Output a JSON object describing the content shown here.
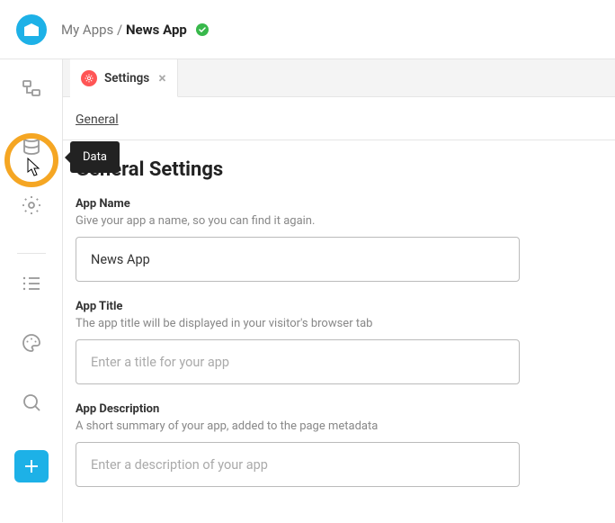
{
  "breadcrumb": {
    "root": "My Apps",
    "sep": "/",
    "current": "News App"
  },
  "tab": {
    "label": "Settings"
  },
  "tooltip": {
    "label": "Data"
  },
  "subnav": {
    "general": "General"
  },
  "section": {
    "title": "General Settings"
  },
  "fields": {
    "appName": {
      "label": "App Name",
      "hint": "Give your app a name, so you can find it again.",
      "value": "News App"
    },
    "appTitle": {
      "label": "App Title",
      "hint": "The app title will be displayed in your visitor's browser tab",
      "placeholder": "Enter a title for your app"
    },
    "appDesc": {
      "label": "App Description",
      "hint": "A short summary of your app, added to the page metadata",
      "placeholder": "Enter a description of your app"
    }
  }
}
